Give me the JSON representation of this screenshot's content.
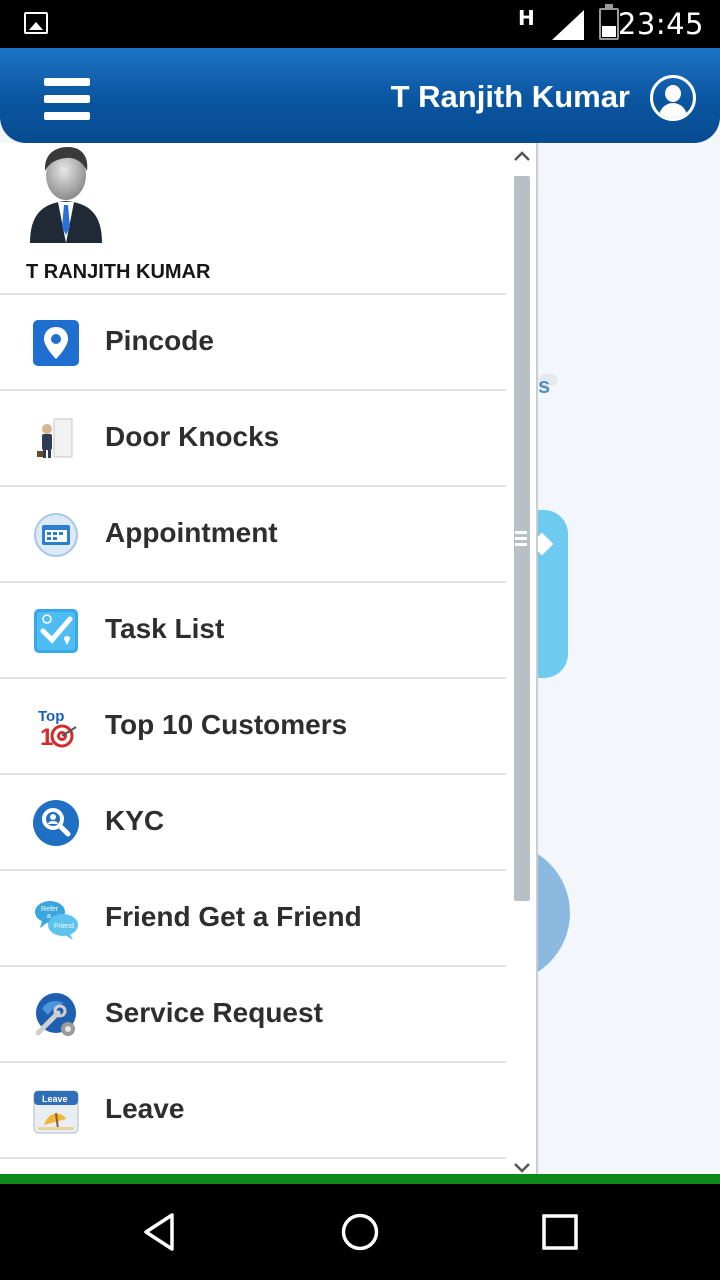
{
  "status_bar": {
    "network_type": "H",
    "time": "23:45",
    "icons": [
      "image-notification-icon",
      "signal-icon",
      "battery-icon"
    ]
  },
  "header": {
    "user_name": "T Ranjith Kumar",
    "menu_icon": "hamburger-menu-icon",
    "profile_icon": "user-profile-icon",
    "color": "#0a559f"
  },
  "drawer": {
    "profile": {
      "name": "T RANJITH KUMAR",
      "avatar_icon": "businessman-avatar-icon"
    },
    "menu": [
      {
        "label": "Pincode",
        "icon": "map-pin-icon"
      },
      {
        "label": "Door Knocks",
        "icon": "door-knock-icon"
      },
      {
        "label": "Appointment",
        "icon": "appointment-icon"
      },
      {
        "label": "Task List",
        "icon": "task-list-icon"
      },
      {
        "label": "Top 10 Customers",
        "icon": "top-10-icon"
      },
      {
        "label": "KYC",
        "icon": "kyc-search-icon"
      },
      {
        "label": "Friend Get a Friend",
        "icon": "refer-friend-icon"
      },
      {
        "label": "Service Request",
        "icon": "service-request-icon"
      },
      {
        "label": "Leave",
        "icon": "leave-calendar-icon"
      }
    ]
  },
  "background": {
    "partial_text": "s"
  },
  "nav_bar": {
    "buttons": [
      "back-icon",
      "home-icon",
      "recents-icon"
    ]
  },
  "colors": {
    "accent_green": "#0e8a1b",
    "header_blue": "#0a559f"
  }
}
